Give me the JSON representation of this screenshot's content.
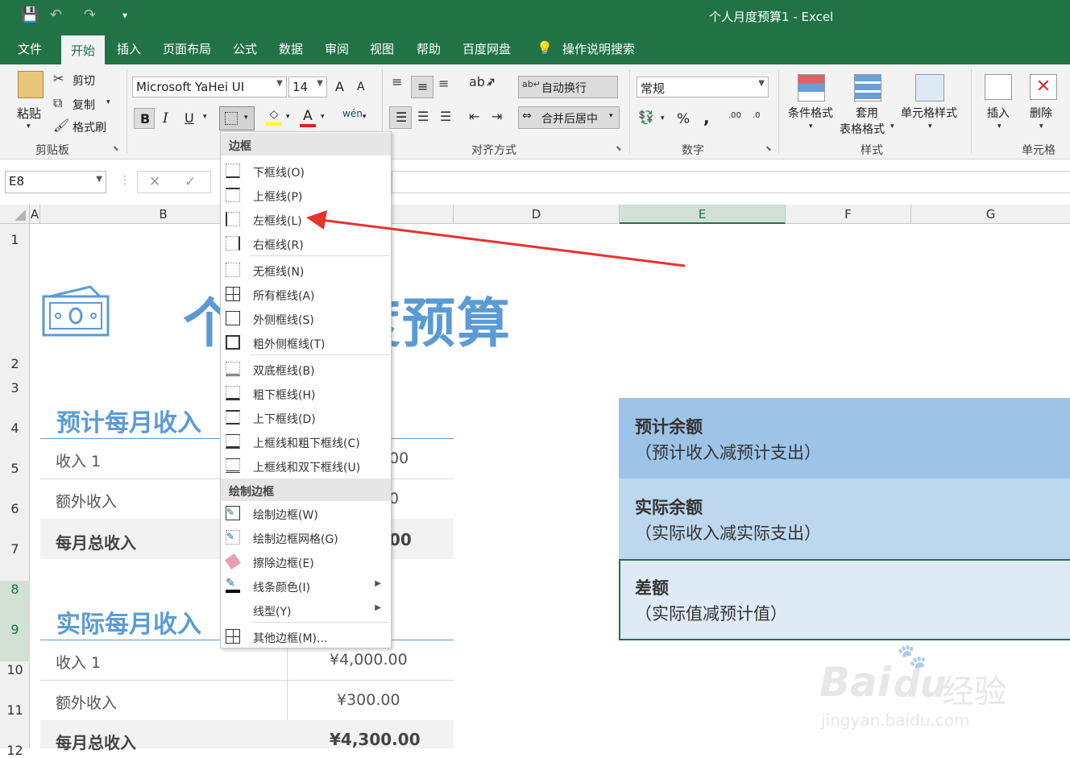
{
  "window": {
    "title": "个人月度预算1  -  Excel"
  },
  "tabs": [
    "文件",
    "开始",
    "插入",
    "页面布局",
    "公式",
    "数据",
    "审阅",
    "视图",
    "帮助",
    "百度网盘"
  ],
  "active_tab": "开始",
  "tell_me": "操作说明搜索",
  "clipboard": {
    "paste": "粘贴",
    "cut": "剪切",
    "copy": "复制",
    "format_painter": "格式刷",
    "group": "剪贴板"
  },
  "font": {
    "name": "Microsoft YaHei UI",
    "size": "14",
    "bold": "B",
    "italic": "I",
    "underline": "U",
    "grow": "A",
    "shrink": "A",
    "font_color_letter": "A"
  },
  "alignment": {
    "wrap": "自动换行",
    "merge": "合并后居中",
    "group": "对齐方式"
  },
  "number": {
    "format": "常规",
    "percent": "%",
    "comma": ",",
    "inc": ".00",
    "dec": ".0",
    "group": "数字"
  },
  "styles": {
    "cond": "条件格式",
    "table1": "套用",
    "table2": "表格格式",
    "cell": "单元格样式",
    "group": "样式"
  },
  "cells": {
    "insert": "插入",
    "delete": "删除",
    "group": "单元格"
  },
  "formula_bar": {
    "name_box": "E8",
    "cancel": "✕",
    "enter": "✓"
  },
  "columns": [
    "A",
    "B",
    "D",
    "E",
    "F",
    "G"
  ],
  "rows": [
    "1",
    "2",
    "3",
    "4",
    "5",
    "6",
    "7",
    "8",
    "9",
    "10",
    "11",
    "12"
  ],
  "sheet": {
    "title": "个人月度预算",
    "income_planned_title": "预计每月收入",
    "income_actual_title": "实际每月收入",
    "rows_planned": [
      {
        "label": "收入 1",
        "value": "00"
      },
      {
        "label": "额外收入",
        "value": "0"
      },
      {
        "label": "每月总收入",
        "value": "00"
      }
    ],
    "rows_actual": [
      {
        "label": "收入 1",
        "value": "¥4,000.00"
      },
      {
        "label": "额外收入",
        "value": "¥300.00"
      },
      {
        "label": "每月总收入",
        "value": "¥4,300.00"
      }
    ],
    "summary": [
      {
        "title": "预计余额",
        "sub": "（预计收入减预计支出）",
        "color": "#9dc3e6"
      },
      {
        "title": "实际余额",
        "sub": "（实际收入减实际支出）",
        "color": "#bdd7ee"
      },
      {
        "title": "差额",
        "sub": "（实际值减预计值）",
        "color": "#deebf7"
      }
    ]
  },
  "border_menu": {
    "header1": "边框",
    "items1": [
      "下框线(O)",
      "上框线(P)",
      "左框线(L)",
      "右框线(R)"
    ],
    "items2": [
      "无框线(N)",
      "所有框线(A)",
      "外侧框线(S)",
      "粗外侧框线(T)"
    ],
    "items3": [
      "双底框线(B)",
      "粗下框线(H)",
      "上下框线(D)",
      "上框线和粗下框线(C)",
      "上框线和双下框线(U)"
    ],
    "header2": "绘制边框",
    "items4": [
      "绘制边框(W)",
      "绘制边框网格(G)",
      "擦除边框(E)",
      "线条颜色(I)",
      "线型(Y)"
    ],
    "items5": [
      "其他边框(M)..."
    ]
  },
  "watermark": {
    "brand": "Bai",
    "brand2": "du",
    "brand_cn": "经验",
    "url": "jingyan.baidu.com"
  },
  "colors": {
    "excel_green": "#217346",
    "accent_blue": "#5b9bd5",
    "arrow_red": "#e8322c"
  }
}
